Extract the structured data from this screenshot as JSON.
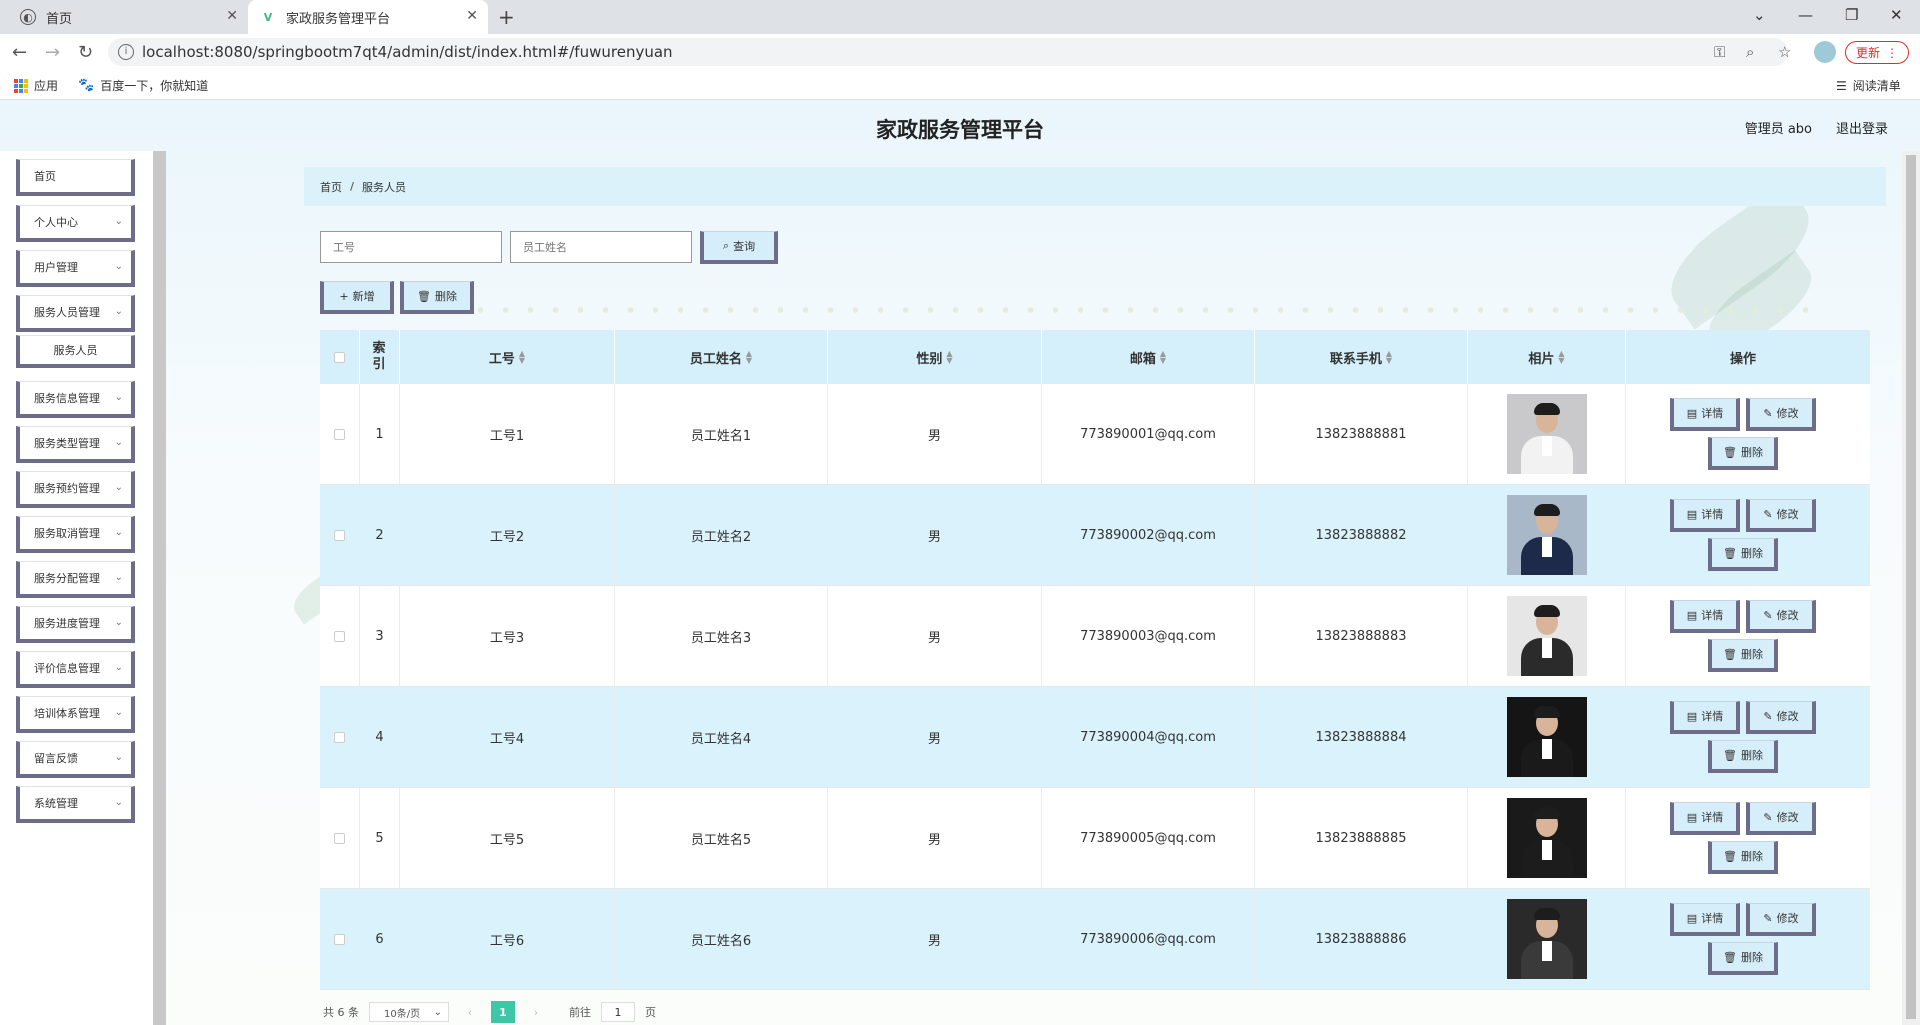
{
  "browser": {
    "tabs": [
      {
        "title": "首页",
        "active": false
      },
      {
        "title": "家政服务管理平台",
        "active": true
      }
    ],
    "url": "localhost:8080/springbootm7qt4/admin/dist/index.html#/fuwurenyuan",
    "update_label": "更新",
    "bookmarks": [
      {
        "label": "应用",
        "icon": "apps-grid-icon"
      },
      {
        "label": "百度一下，你就知道",
        "icon": "baidu-paw-icon"
      }
    ],
    "reading_list": "阅读清单"
  },
  "header": {
    "title": "家政服务管理平台",
    "admin": "管理员 abo",
    "logout": "退出登录"
  },
  "sidebar": {
    "items": [
      {
        "label": "首页",
        "chevron": false
      },
      {
        "label": "个人中心",
        "chevron": true
      },
      {
        "label": "用户管理",
        "chevron": true
      },
      {
        "label": "服务人员管理",
        "chevron": true
      },
      {
        "label": "服务人员",
        "chevron": false,
        "sub": true
      },
      {
        "label": "服务信息管理",
        "chevron": true
      },
      {
        "label": "服务类型管理",
        "chevron": true
      },
      {
        "label": "服务预约管理",
        "chevron": true
      },
      {
        "label": "服务取消管理",
        "chevron": true
      },
      {
        "label": "服务分配管理",
        "chevron": true
      },
      {
        "label": "服务进度管理",
        "chevron": true
      },
      {
        "label": "评价信息管理",
        "chevron": true
      },
      {
        "label": "培训体系管理",
        "chevron": true
      },
      {
        "label": "留言反馈",
        "chevron": true
      },
      {
        "label": "系统管理",
        "chevron": true
      }
    ]
  },
  "breadcrumb": {
    "home": "首页",
    "current": "服务人员",
    "separator": "/"
  },
  "search": {
    "gonghao_placeholder": "工号",
    "name_placeholder": "员工姓名",
    "query_label": "查询"
  },
  "actions": {
    "add_label": "新增",
    "delete_label": "删除"
  },
  "table": {
    "headers": {
      "index": "索引",
      "gonghao": "工号",
      "name": "员工姓名",
      "gender": "性别",
      "email": "邮箱",
      "phone": "联系手机",
      "photo": "相片",
      "ops": "操作"
    },
    "op_labels": {
      "detail": "详情",
      "edit": "修改",
      "delete": "删除"
    },
    "rows": [
      {
        "index": "1",
        "gonghao": "工号1",
        "name": "员工姓名1",
        "gender": "男",
        "email": "773890001@qq.com",
        "phone": "13823888881"
      },
      {
        "index": "2",
        "gonghao": "工号2",
        "name": "员工姓名2",
        "gender": "男",
        "email": "773890002@qq.com",
        "phone": "13823888882"
      },
      {
        "index": "3",
        "gonghao": "工号3",
        "name": "员工姓名3",
        "gender": "男",
        "email": "773890003@qq.com",
        "phone": "13823888883"
      },
      {
        "index": "4",
        "gonghao": "工号4",
        "name": "员工姓名4",
        "gender": "男",
        "email": "773890004@qq.com",
        "phone": "13823888884"
      },
      {
        "index": "5",
        "gonghao": "工号5",
        "name": "员工姓名5",
        "gender": "男",
        "email": "773890005@qq.com",
        "phone": "13823888885"
      },
      {
        "index": "6",
        "gonghao": "工号6",
        "name": "员工姓名6",
        "gender": "男",
        "email": "773890006@qq.com",
        "phone": "13823888886"
      }
    ]
  },
  "pagination": {
    "total": "共 6 条",
    "page_size": "10条/页",
    "current_page": "1",
    "goto_label": "前往",
    "goto_value": "1",
    "page_suffix": "页"
  },
  "colors": {
    "accent": "#d6eef9",
    "border_accent": "#6d6d8a",
    "row_highlight": "#daf2fc",
    "page_active": "#3ec7a6"
  }
}
